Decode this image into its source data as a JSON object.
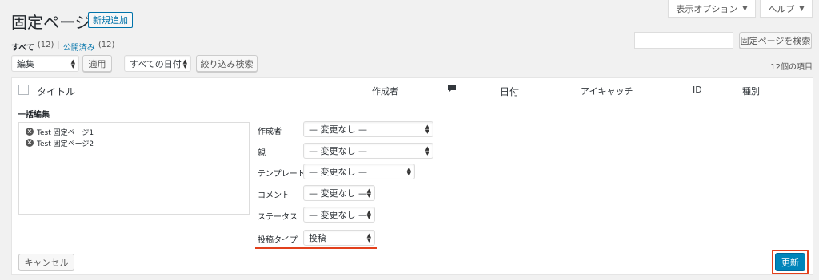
{
  "header": {
    "page_title": "固定ページ",
    "add_new": "新規追加"
  },
  "screen_tabs": {
    "display_options": "表示オプション",
    "help": "ヘルプ"
  },
  "subsubsub": {
    "all_label": "すべて",
    "all_count": "(12)",
    "separator": "|",
    "published_label": "公開済み",
    "published_count": "(12)"
  },
  "search": {
    "placeholder": "",
    "button": "固定ページを検索"
  },
  "tablenav": {
    "bulk_action_selected": "編集",
    "apply": "適用",
    "date_filter_selected": "すべての日付",
    "filter_button": "絞り込み検索",
    "items_count": "12個の項目"
  },
  "table_columns": {
    "title": "タイトル",
    "author": "作成者",
    "comments_icon": "comment-bubble",
    "date": "日付",
    "featured_image": "アイキャッチ",
    "id": "ID",
    "type": "種別"
  },
  "bulk_edit": {
    "heading": "一括編集",
    "items": [
      "Test 固定ページ1",
      "Test 固定ページ2"
    ],
    "fields": {
      "author": {
        "label": "作成者",
        "value": "— 変更なし —"
      },
      "parent": {
        "label": "親",
        "value": "— 変更なし —"
      },
      "template": {
        "label": "テンプレート",
        "value": "— 変更なし —"
      },
      "comments": {
        "label": "コメント",
        "value": "— 変更なし —"
      },
      "status": {
        "label": "ステータス",
        "value": "— 変更なし —"
      },
      "post_type": {
        "label": "投稿タイプ",
        "value": "投稿"
      }
    },
    "cancel": "キャンセル",
    "update": "更新"
  },
  "colors": {
    "link": "#0073aa",
    "primary_button": "#0085ba",
    "highlight": "#e2401c"
  }
}
